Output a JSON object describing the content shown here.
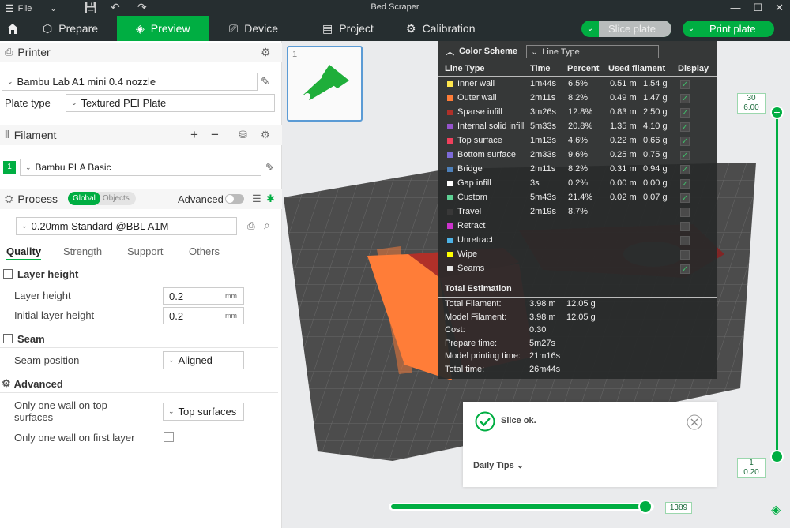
{
  "titlebar": {
    "file_label": "File",
    "title": "Bed Scraper"
  },
  "tabs": {
    "prepare": "Prepare",
    "preview": "Preview",
    "device": "Device",
    "project": "Project",
    "calibration": "Calibration"
  },
  "actions": {
    "slice_plate": "Slice plate",
    "print_plate": "Print plate"
  },
  "printer": {
    "section": "Printer",
    "selected": "Bambu Lab A1 mini 0.4 nozzle",
    "plate_type_label": "Plate type",
    "plate_type_value": "Textured PEI Plate"
  },
  "filament": {
    "section": "Filament",
    "slot_number": "1",
    "name": "Bambu PLA Basic"
  },
  "process": {
    "section": "Process",
    "toggle_global": "Global",
    "toggle_objects": "Objects",
    "advanced_label": "Advanced",
    "preset": "0.20mm Standard @BBL A1M"
  },
  "quality_tabs": [
    "Quality",
    "Strength",
    "Support",
    "Others"
  ],
  "settings": {
    "layer_height_group": "Layer height",
    "layer_height_label": "Layer height",
    "layer_height_value": "0.2",
    "layer_height_unit": "mm",
    "initial_layer_label": "Initial layer height",
    "initial_layer_value": "0.2",
    "initial_layer_unit": "mm",
    "seam_group": "Seam",
    "seam_position_label": "Seam position",
    "seam_position_value": "Aligned",
    "advanced_group": "Advanced",
    "one_wall_top_label_line1": "Only one wall on top",
    "one_wall_top_label_line2": "surfaces",
    "one_wall_top_value": "Top surfaces",
    "one_wall_first_label": "Only one wall on first layer"
  },
  "plate_thumb": {
    "number": "1"
  },
  "legend": {
    "title": "Color Scheme",
    "scheme": "Line Type",
    "columns": {
      "type": "Line Type",
      "time": "Time",
      "percent": "Percent",
      "used": "Used filament",
      "display": "Display"
    },
    "rows": [
      {
        "name": "Inner wall",
        "color": "#ffe64d",
        "time": "1m44s",
        "pct": "6.5%",
        "len": "0.51 m",
        "wt": "1.54 g",
        "on": true
      },
      {
        "name": "Outer wall",
        "color": "#ff7d38",
        "time": "2m11s",
        "pct": "8.2%",
        "len": "0.49 m",
        "wt": "1.47 g",
        "on": true
      },
      {
        "name": "Sparse infill",
        "color": "#b03029",
        "time": "3m26s",
        "pct": "12.8%",
        "len": "0.83 m",
        "wt": "2.50 g",
        "on": true
      },
      {
        "name": "Internal solid infill",
        "color": "#9654cc",
        "time": "5m33s",
        "pct": "20.8%",
        "len": "1.35 m",
        "wt": "4.10 g",
        "on": true
      },
      {
        "name": "Top surface",
        "color": "#f0405c",
        "time": "1m13s",
        "pct": "4.6%",
        "len": "0.22 m",
        "wt": "0.66 g",
        "on": true
      },
      {
        "name": "Bottom surface",
        "color": "#7d6bd9",
        "time": "2m33s",
        "pct": "9.6%",
        "len": "0.25 m",
        "wt": "0.75 g",
        "on": true
      },
      {
        "name": "Bridge",
        "color": "#4d80ba",
        "time": "2m11s",
        "pct": "8.2%",
        "len": "0.31 m",
        "wt": "0.94 g",
        "on": true
      },
      {
        "name": "Gap infill",
        "color": "#ffffff",
        "time": "3s",
        "pct": "0.2%",
        "len": "0.00 m",
        "wt": "0.00 g",
        "on": true
      },
      {
        "name": "Custom",
        "color": "#5ed194",
        "time": "5m43s",
        "pct": "21.4%",
        "len": "0.02 m",
        "wt": "0.07 g",
        "on": true
      },
      {
        "name": "Travel",
        "color": "#383838",
        "time": "2m19s",
        "pct": "8.7%",
        "len": "",
        "wt": "",
        "on": false
      },
      {
        "name": "Retract",
        "color": "#cc33cc",
        "time": "",
        "pct": "",
        "len": "",
        "wt": "",
        "on": false
      },
      {
        "name": "Unretract",
        "color": "#4db3e6",
        "time": "",
        "pct": "",
        "len": "",
        "wt": "",
        "on": false
      },
      {
        "name": "Wipe",
        "color": "#ffff00",
        "time": "",
        "pct": "",
        "len": "",
        "wt": "",
        "on": false
      },
      {
        "name": "Seams",
        "color": "#e6e6e6",
        "time": "",
        "pct": "",
        "len": "",
        "wt": "",
        "on": true
      }
    ],
    "totals_title": "Total Estimation",
    "totals": [
      {
        "label": "Total Filament:",
        "v1": "3.98 m",
        "v2": "12.05 g"
      },
      {
        "label": "Model Filament:",
        "v1": "3.98 m",
        "v2": "12.05 g"
      },
      {
        "label": "Cost:",
        "v1": "0.30",
        "v2": ""
      },
      {
        "label": "Prepare time:",
        "v1": "5m27s",
        "v2": ""
      },
      {
        "label": "Model printing time:",
        "v1": "21m16s",
        "v2": ""
      },
      {
        "label": "Total time:",
        "v1": "26m44s",
        "v2": ""
      }
    ]
  },
  "slice_popup": {
    "message": "Slice ok.",
    "tips": "Daily Tips"
  },
  "vslider": {
    "top_layer": "30",
    "top_height": "6.00",
    "bottom_layer": "1",
    "bottom_height": "0.20",
    "top_fraction": 1.0,
    "bottom_fraction": 0.0
  },
  "hslider": {
    "value": "1389",
    "fraction": 1.0
  },
  "colors": {
    "accent": "#00ae42",
    "dark": "#262e30"
  }
}
